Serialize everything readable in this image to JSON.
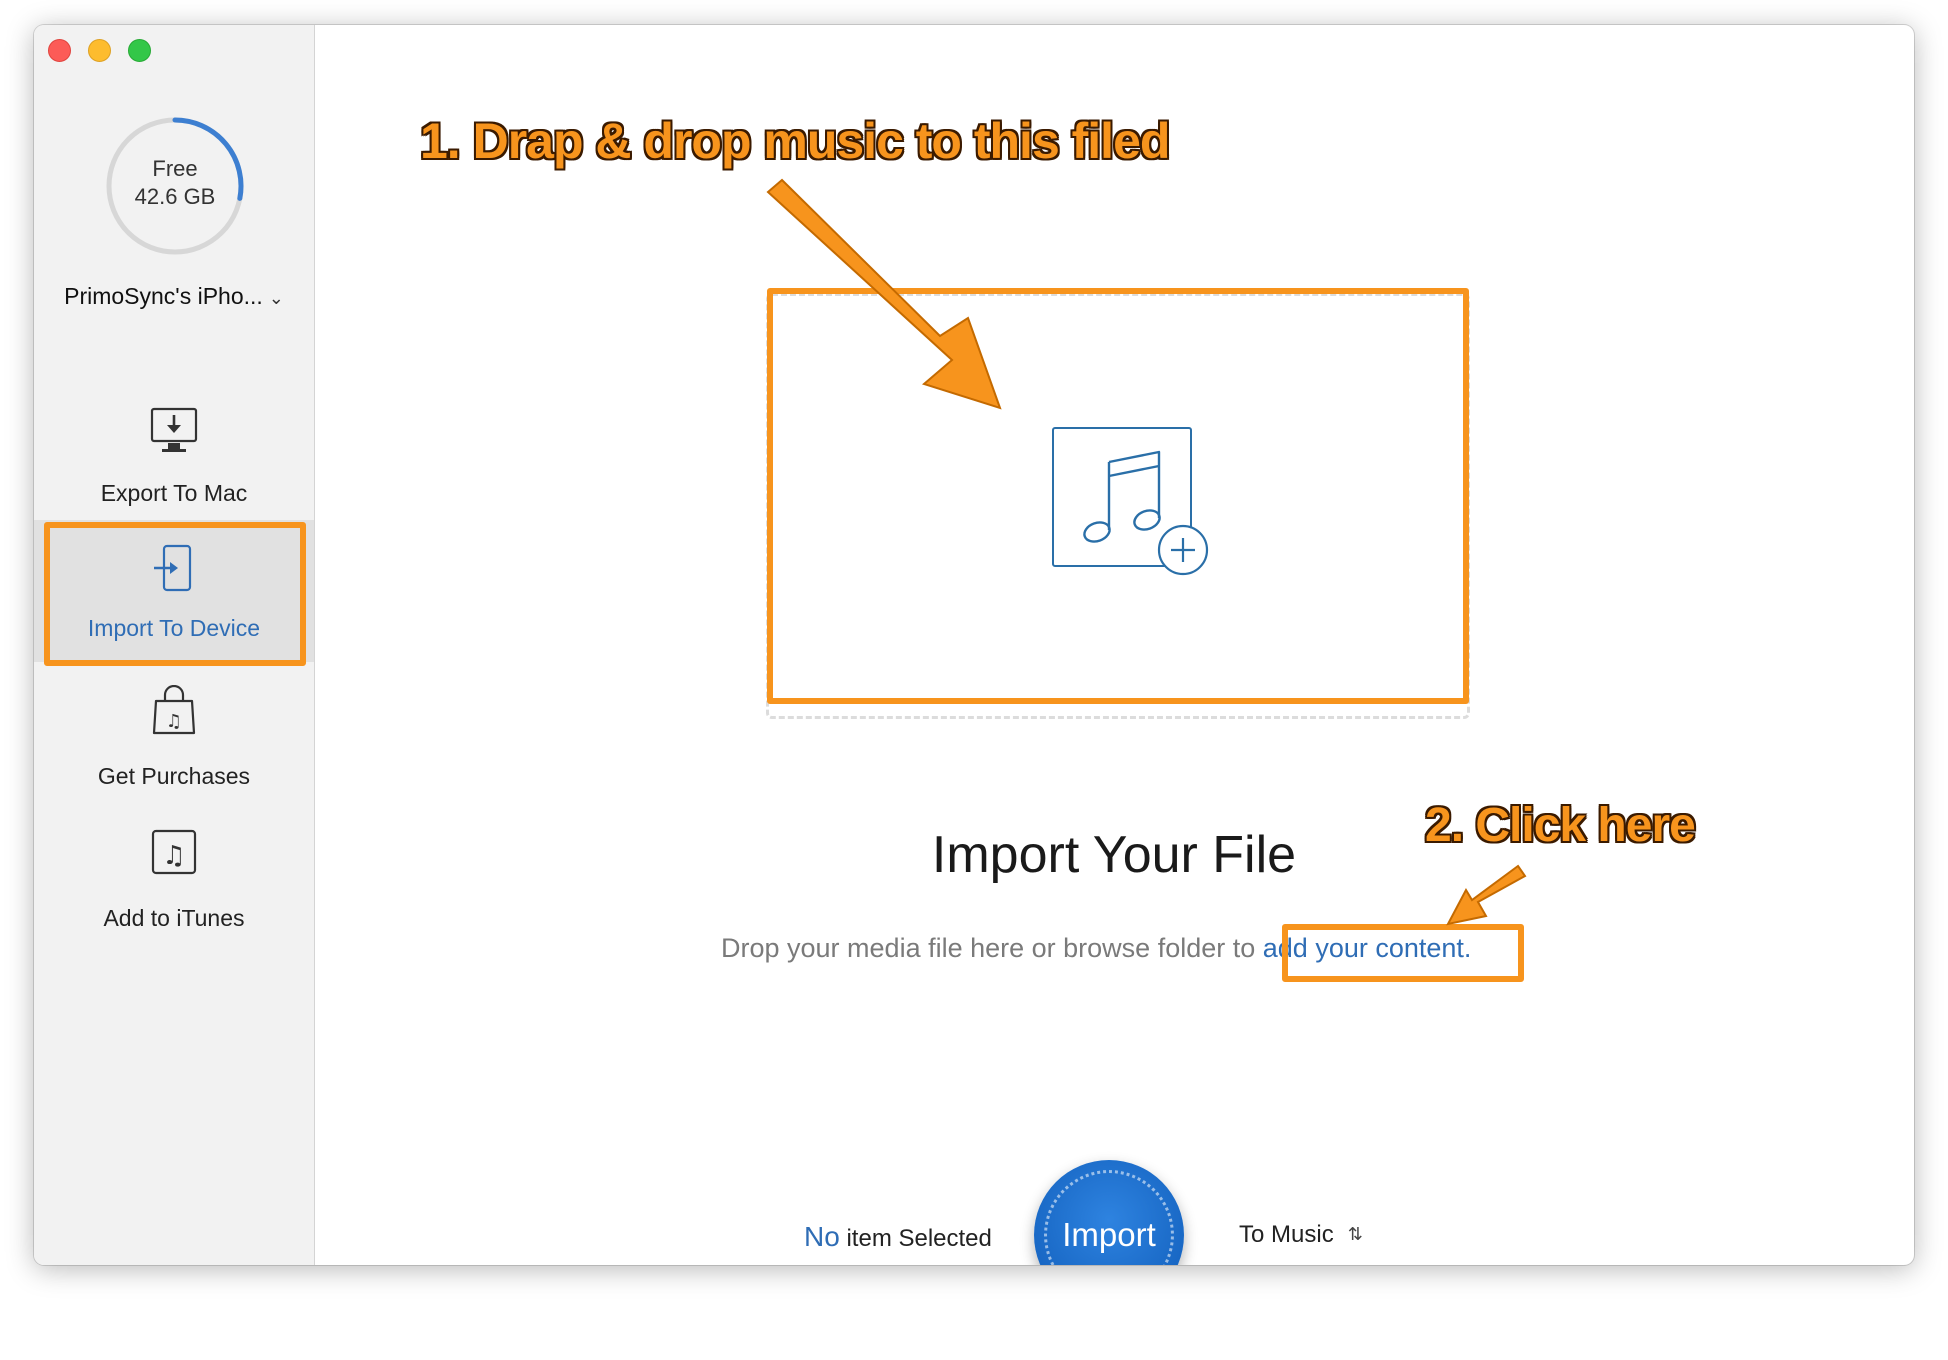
{
  "sidebar": {
    "storage": {
      "label": "Free",
      "value": "42.6 GB",
      "used_fraction": 0.28
    },
    "device_name": "PrimoSync's iPho...",
    "items": [
      {
        "label": "Export To Mac",
        "icon": "export-to-mac-icon"
      },
      {
        "label": "Import To Device",
        "icon": "import-to-device-icon",
        "active": true
      },
      {
        "label": "Get Purchases",
        "icon": "shopping-bag-icon"
      },
      {
        "label": "Add to iTunes",
        "icon": "itunes-note-icon"
      }
    ]
  },
  "main": {
    "title": "Import Your File",
    "subtitle_prefix": "Drop your media file here or browse folder to ",
    "subtitle_link": "add your content.",
    "drop_icon": "music-add-icon"
  },
  "annotations": {
    "step1": "1. Drap & drop music to this filed",
    "step2": "2. Click here"
  },
  "footer": {
    "status_count": "No",
    "status_text": " item Selected",
    "import_label": "Import",
    "destination": "To Music"
  },
  "colors": {
    "accent_blue": "#2f6db5",
    "annotation_orange": "#f7941d",
    "import_button": "#1867c4"
  }
}
